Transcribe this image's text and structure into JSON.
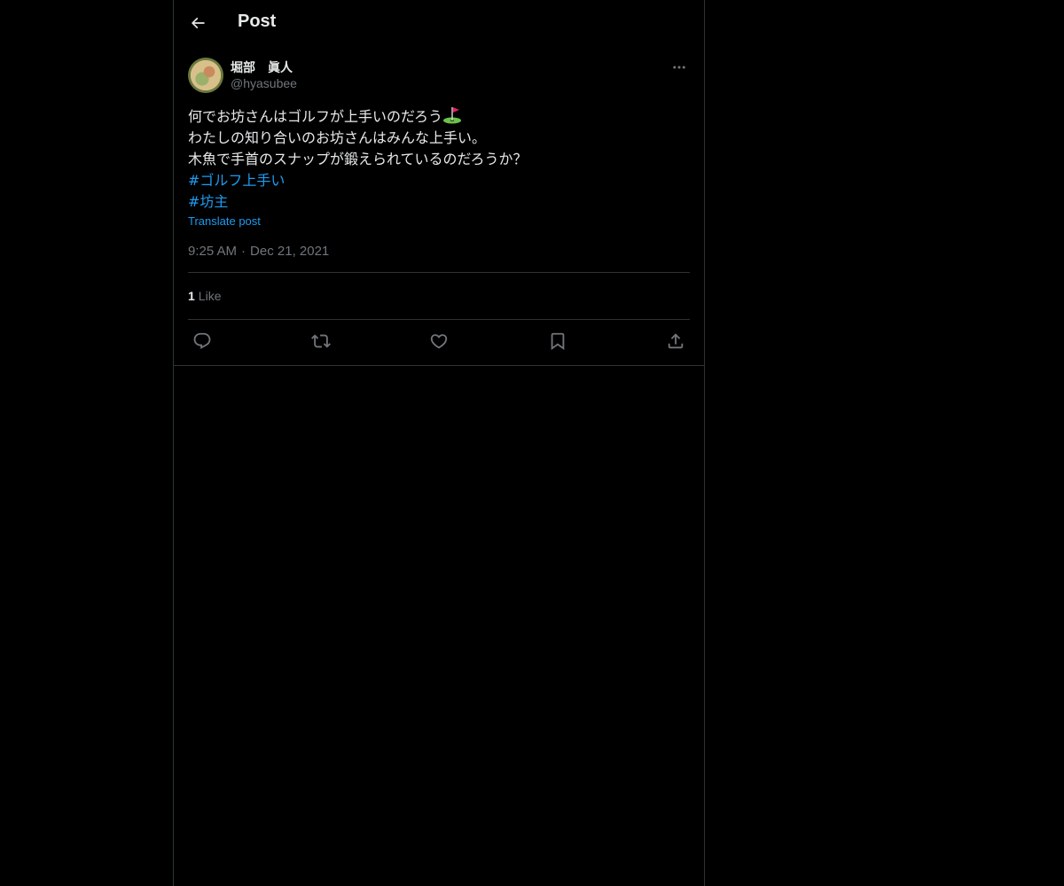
{
  "topbar": {
    "title": "Post"
  },
  "author": {
    "display_name": "堀部　眞人",
    "handle": "@hyasubee"
  },
  "post": {
    "lines": [
      "何でお坊さんはゴルフが上手いのだろう",
      "わたしの知り合いのお坊さんはみんな上手い。",
      "木魚で手首のスナップが鍛えられているのだろうか？"
    ],
    "hashtags": [
      "#ゴルフ上手い",
      "#坊主"
    ],
    "translate_label": "Translate post",
    "time": "9:25 AM",
    "separator": "·",
    "date": "Dec 21, 2021"
  },
  "stats": {
    "likes_count": "1",
    "likes_label": "Like"
  },
  "actions": {
    "icons": [
      "reply-icon",
      "repost-icon",
      "like-icon",
      "bookmark-icon",
      "share-icon"
    ]
  },
  "colors": {
    "background": "#000000",
    "text": "#e7e9ea",
    "muted": "#71767b",
    "link": "#1d9bf0",
    "border": "#2f3336"
  }
}
